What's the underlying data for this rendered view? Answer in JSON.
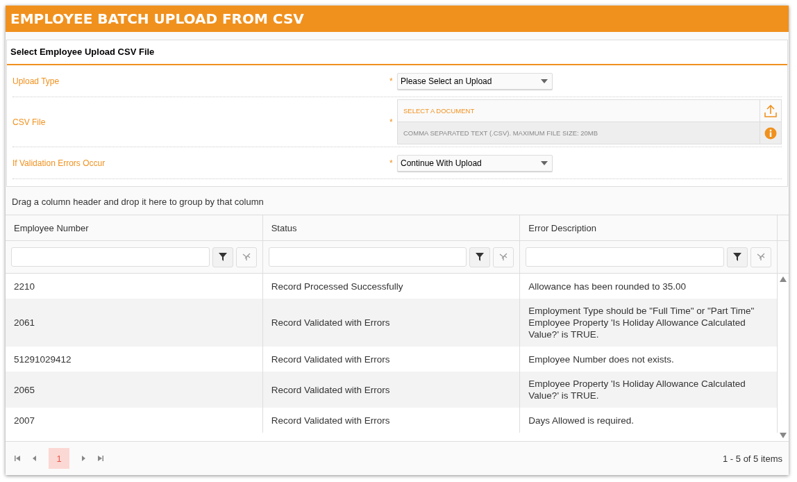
{
  "header": {
    "title": "EMPLOYEE BATCH UPLOAD FROM CSV"
  },
  "form": {
    "title": "Select Employee Upload CSV File",
    "fields": [
      {
        "kind": "select",
        "label": "Upload Type",
        "required_mark": "*",
        "value": "Please Select an Upload"
      },
      {
        "kind": "file",
        "label": "CSV File",
        "required_mark": "*",
        "placeholder": "SELECT A DOCUMENT",
        "hint": "COMMA SEPARATED TEXT (.CSV). MAXIMUM FILE SIZE: 20MB"
      },
      {
        "kind": "select",
        "label": "If Validation Errors Occur",
        "required_mark": "*",
        "value": "Continue With Upload"
      }
    ]
  },
  "grid": {
    "group_hint": "Drag a column header and drop it here to group by that column",
    "columns": [
      "Employee Number",
      "Status",
      "Error Description"
    ],
    "rows": [
      {
        "cells": [
          "2210",
          "Record Processed Successfully",
          "Allowance has been rounded to 35.00"
        ]
      },
      {
        "cells": [
          "2061",
          "Record Validated with Errors",
          "Employment Type should be \"Full Time\" or \"Part Time\" Employee Property 'Is Holiday Allowance Calculated Value?' is TRUE."
        ]
      },
      {
        "cells": [
          "51291029412",
          "Record Validated with Errors",
          "Employee Number does not exists."
        ]
      },
      {
        "cells": [
          "2065",
          "Record Validated with Errors",
          "Employee Property 'Is Holiday Allowance Calculated Value?' is TRUE."
        ]
      },
      {
        "cells": [
          "2007",
          "Record Validated with Errors",
          "Days Allowed is required."
        ]
      }
    ],
    "pager": {
      "pages": [
        {
          "label": "1",
          "selected": true
        }
      ],
      "summary": "1 - 5 of 5 items"
    }
  }
}
